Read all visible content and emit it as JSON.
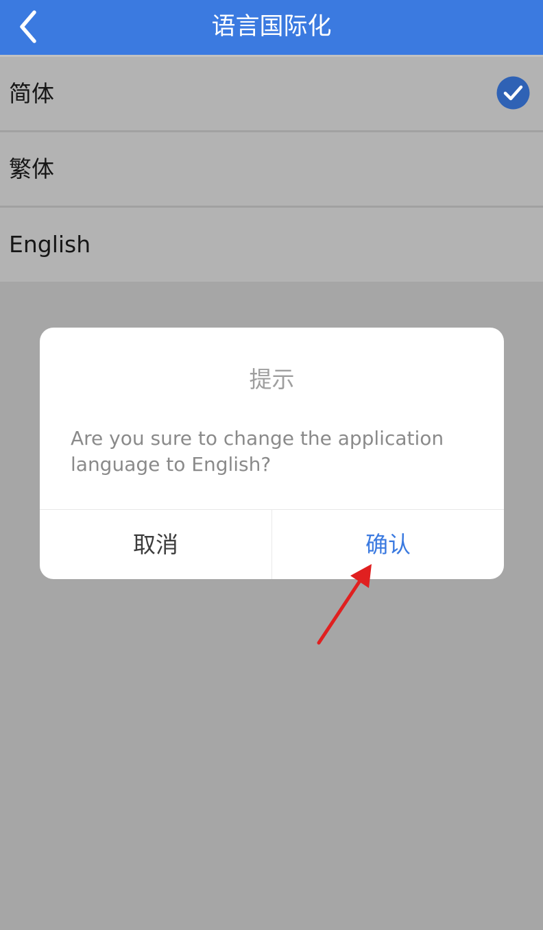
{
  "header": {
    "title": "语言国际化",
    "back_icon": "chevron-left-icon",
    "background_color": "#3b7ae0"
  },
  "languages": {
    "items": [
      {
        "label": "简体",
        "selected": true
      },
      {
        "label": "繁体",
        "selected": false
      },
      {
        "label": "English",
        "selected": false
      }
    ],
    "selected_icon": "check-circle-icon",
    "selected_icon_color": "#2f62b5"
  },
  "dialog": {
    "title": "提示",
    "message": "Are you sure to change the application language to English?",
    "cancel_label": "取消",
    "confirm_label": "确认",
    "confirm_color": "#3b7ae0"
  },
  "annotation": {
    "icon": "red-arrow-icon",
    "color": "#e02020",
    "points_to": "confirm-button"
  }
}
